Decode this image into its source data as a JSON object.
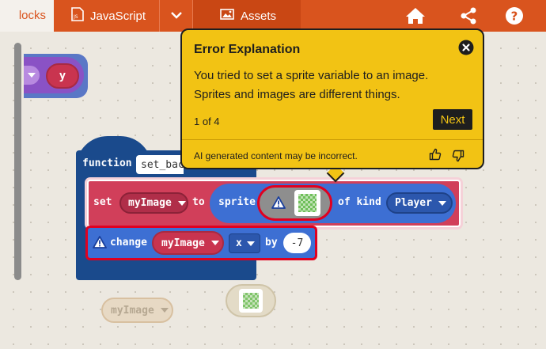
{
  "topbar": {
    "tabs": [
      {
        "label": "locks"
      },
      {
        "label": "JavaScript",
        "icon": "js-file-icon"
      },
      {
        "label": "",
        "icon": "chevron-down-icon"
      },
      {
        "label": "Assets",
        "icon": "image-icon"
      }
    ],
    "icons": [
      "home-icon",
      "share-icon",
      "help-icon"
    ]
  },
  "blocks": {
    "partial_var": "y",
    "function_keyword": "function",
    "function_name": "set_bac",
    "set_keyword": "set",
    "set_var": "myImage",
    "to_keyword": "to",
    "sprite_keyword": "sprite",
    "of_kind": "of kind",
    "kind_value": "Player",
    "change_keyword": "change",
    "change_var": "myImage",
    "change_axis": "x",
    "by_keyword": "by",
    "by_value": "-7",
    "loose_var": "myImage"
  },
  "tooltip": {
    "title": "Error Explanation",
    "body": "You tried to set a sprite variable to an image. Sprites and images are different things.",
    "step": "1 of 4",
    "next_label": "Next",
    "disclaimer": "AI generated content may be incorrect."
  },
  "colors": {
    "topbar": "#d9541e",
    "function_block": "#1a4a8c",
    "set_block": "#d13f5a",
    "sprite_block": "#3d6fd3",
    "tooltip_bg": "#f2c314",
    "error_outline": "#e00020"
  }
}
